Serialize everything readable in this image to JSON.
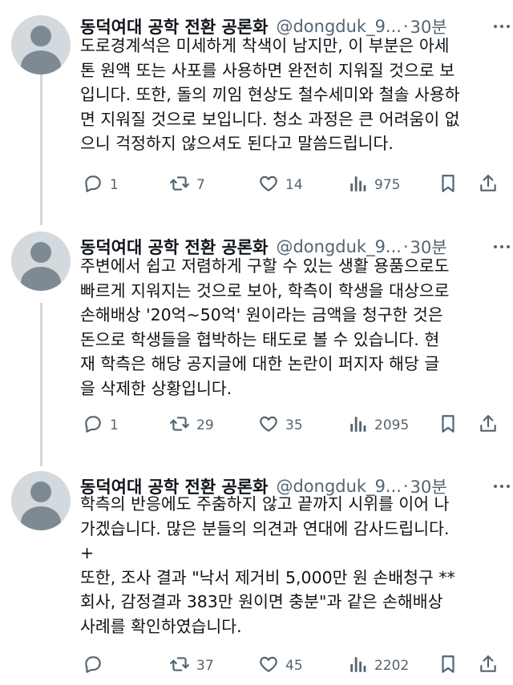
{
  "tweets": [
    {
      "author_name": "동덕여대 공학 전환 공론화",
      "handle": "@dongduk_9...",
      "separator": "·",
      "time": "30분",
      "lines": [
        "도로경계석은 미세하게 착색이 남지만, 이 부분은 아세",
        "톤 원액 또는 사포를 사용하면 완전히 지워질 것으로 보",
        "입니다. 또한, 돌의 끼임 현상도 철수세미와 철솔 사용하",
        "면 지워질 것으로 보입니다. 청소 과정은 큰 어려움이 없",
        "으니 걱정하지 않으셔도 된다고 말씀드립니다."
      ],
      "reply_count": "1",
      "repost_count": "7",
      "like_count": "14",
      "view_count": "975"
    },
    {
      "author_name": "동덕여대 공학 전환 공론화",
      "handle": "@dongduk_9...",
      "separator": "·",
      "time": "30분",
      "lines": [
        "주변에서 쉽고 저렴하게 구할 수 있는 생활 용품으로도",
        "빠르게 지워지는 것으로 보아, 학측이 학생을 대상으로",
        "손해배상 '20억~50억' 원이라는 금액을 청구한 것은",
        "돈으로 학생들을 협박하는 태도로 볼 수 있습니다. 현",
        "재 학측은 해당 공지글에 대한 논란이 퍼지자 해당 글",
        "을 삭제한 상황입니다."
      ],
      "reply_count": "1",
      "repost_count": "29",
      "like_count": "35",
      "view_count": "2095"
    },
    {
      "author_name": "동덕여대 공학 전환 공론화",
      "handle": "@dongduk_9...",
      "separator": "·",
      "time": "30분",
      "lines": [
        "학측의 반응에도 주춤하지 않고 끝까지 시위를 이어 나",
        "가겠습니다. 많은 분들의 의견과 연대에 감사드립니다.",
        "+",
        "또한, 조사 결과 \"낙서 제거비 5,000만 원 손배청구 **",
        "회사, 감정결과 383만 원이면 충분\"과 같은 손해배상",
        "사례를 확인하였습니다."
      ],
      "reply_count": "",
      "repost_count": "37",
      "like_count": "45",
      "view_count": "2202"
    }
  ],
  "icons": {
    "reply": "reply-icon",
    "repost": "repost-icon",
    "like": "like-icon",
    "views": "views-icon",
    "bookmark": "bookmark-icon",
    "share": "share-icon",
    "more": "more-icon"
  },
  "colors": {
    "text": "#0f1419",
    "secondary": "#536471",
    "thread_line": "#cfd9de",
    "avatar_bg": "#d4d9dd",
    "avatar_fg": "#7e8a93"
  }
}
